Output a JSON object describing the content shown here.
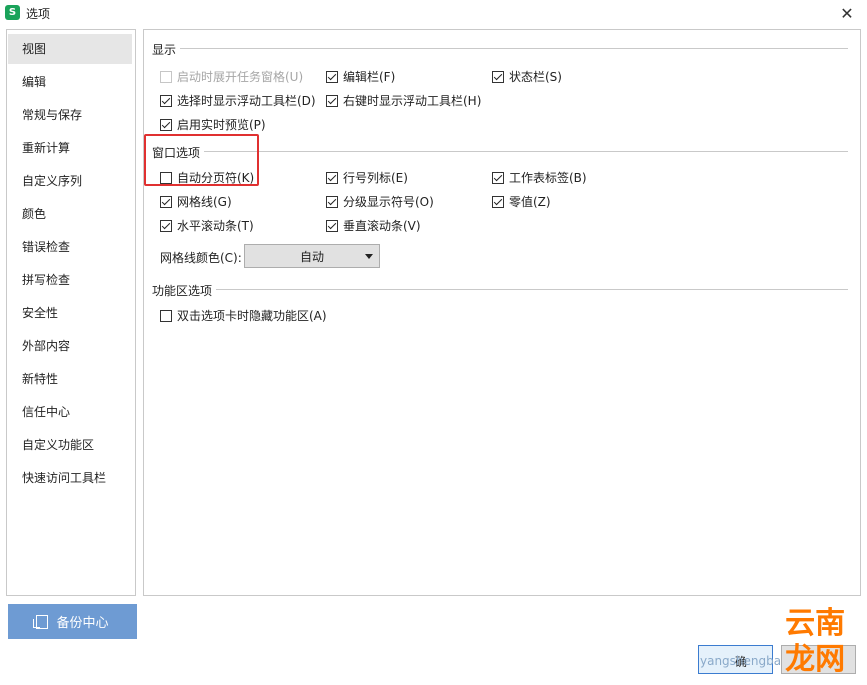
{
  "window": {
    "icon_glyph": "S",
    "title": "选项",
    "close_glyph": "✕"
  },
  "sidebar": {
    "items": [
      {
        "label": "视图",
        "active": true
      },
      {
        "label": "编辑"
      },
      {
        "label": "常规与保存"
      },
      {
        "label": "重新计算"
      },
      {
        "label": "自定义序列"
      },
      {
        "label": "颜色"
      },
      {
        "label": "错误检查"
      },
      {
        "label": "拼写检查"
      },
      {
        "label": "安全性"
      },
      {
        "label": "外部内容"
      },
      {
        "label": "新特性"
      },
      {
        "label": "信任中心"
      },
      {
        "label": "自定义功能区"
      },
      {
        "label": "快速访问工具栏"
      }
    ],
    "backup_label": "备份中心"
  },
  "display": {
    "title": "显示",
    "options": [
      {
        "label": "启动时展开任务窗格(U)",
        "checked": false,
        "disabled": true
      },
      {
        "label": "编辑栏(F)",
        "checked": true
      },
      {
        "label": "状态栏(S)",
        "checked": true
      },
      {
        "label": "选择时显示浮动工具栏(D)",
        "checked": true
      },
      {
        "label": "右键时显示浮动工具栏(H)",
        "checked": true
      },
      {
        "label": "启用实时预览(P)",
        "checked": true
      }
    ]
  },
  "window_options": {
    "title": "窗口选项",
    "options": [
      {
        "label": "自动分页符(K)",
        "checked": false
      },
      {
        "label": "行号列标(E)",
        "checked": true
      },
      {
        "label": "工作表标签(B)",
        "checked": true
      },
      {
        "label": "网格线(G)",
        "checked": true
      },
      {
        "label": "分级显示符号(O)",
        "checked": true
      },
      {
        "label": "零值(Z)",
        "checked": true
      },
      {
        "label": "水平滚动条(T)",
        "checked": true
      },
      {
        "label": "垂直滚动条(V)",
        "checked": true
      }
    ],
    "grid_color_label": "网格线颜色(C):",
    "grid_color_value": "自动"
  },
  "ribbon": {
    "title": "功能区选项",
    "options": [
      {
        "label": "双击选项卡时隐藏功能区(A)",
        "checked": false
      }
    ]
  },
  "footer": {
    "ok_label": "确"
  },
  "watermark": {
    "small": "yangshengba",
    "big": "云南龙网"
  }
}
